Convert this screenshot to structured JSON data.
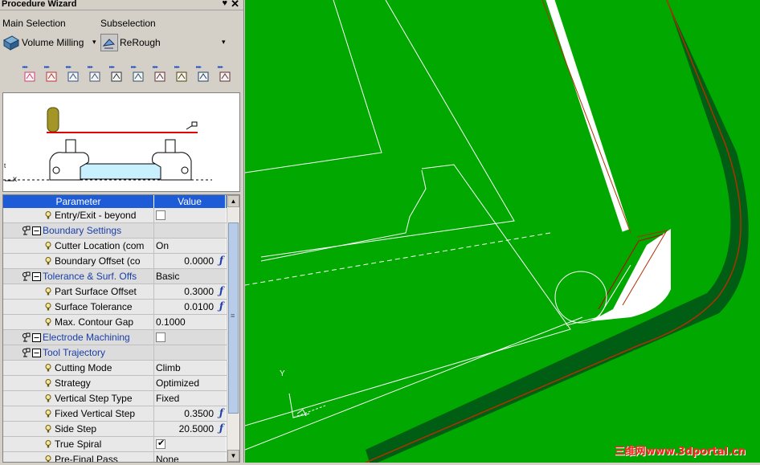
{
  "window": {
    "title": "Procedure Wizard",
    "pin_glyph": "♥",
    "close_glyph": "✕"
  },
  "main_selection": {
    "label": "Main Selection",
    "value": "Volume Milling",
    "icon": "volume-milling-icon"
  },
  "subselection": {
    "label": "Subselection",
    "value": "ReRough",
    "icon": "rerough-icon"
  },
  "dropdown_glyph": "▾",
  "toolbar": {
    "arrow": "▸▸▸",
    "buttons": [
      "eraser-icon",
      "tool-icon",
      "motion-icon",
      "strategy-icon",
      "display-icon",
      "link-icon",
      "approach-icon",
      "save-icon",
      "simulate-icon",
      "options-icon"
    ]
  },
  "preview": {
    "axis_label": "x",
    "tick_label": "t"
  },
  "grid": {
    "headers": {
      "parameter": "Parameter",
      "value": "Value"
    },
    "rows": [
      {
        "type": "param",
        "label": "Entry/Exit - beyond",
        "value_type": "checkbox",
        "checked": false
      },
      {
        "type": "group",
        "label": "Boundary Settings",
        "value": ""
      },
      {
        "type": "param",
        "label": "Cutter Location (com",
        "value": "On"
      },
      {
        "type": "param",
        "label": "Boundary Offset (co",
        "value": "0.0000",
        "formula": "ƒ"
      },
      {
        "type": "group",
        "label": "Tolerance & Surf. Offs",
        "value": "Basic"
      },
      {
        "type": "param",
        "label": "Part Surface Offset",
        "value": "0.3000",
        "formula": "ƒ"
      },
      {
        "type": "param",
        "label": "Surface Tolerance",
        "value": "0.0100",
        "formula": "ƒ"
      },
      {
        "type": "param",
        "label": "Max. Contour Gap",
        "value": "0.1000"
      },
      {
        "type": "group",
        "label": "Electrode Machining",
        "value_type": "checkbox",
        "checked": false
      },
      {
        "type": "group",
        "label": "Tool Trajectory",
        "value": ""
      },
      {
        "type": "param",
        "label": "Cutting Mode",
        "value": "Climb"
      },
      {
        "type": "param",
        "label": "Strategy",
        "value": "Optimized"
      },
      {
        "type": "param",
        "label": "Vertical Step Type",
        "value": "Fixed"
      },
      {
        "type": "param",
        "label": "Fixed Vertical Step",
        "value": "0.3500",
        "formula": "ƒ"
      },
      {
        "type": "param",
        "label": "Side Step",
        "value": "20.5000",
        "formula": "ƒ"
      },
      {
        "type": "param",
        "label": "True Spiral",
        "value_type": "checkbox",
        "checked": true
      },
      {
        "type": "param",
        "label": "Pre-Final Pass",
        "value": "None"
      }
    ],
    "scrollbar": {
      "up": "▲",
      "down": "▼",
      "grip": "≡"
    }
  },
  "viewport": {
    "background": "#00a800",
    "axis_label": "Y",
    "watermark": "三维网www.3dportal.cn"
  }
}
